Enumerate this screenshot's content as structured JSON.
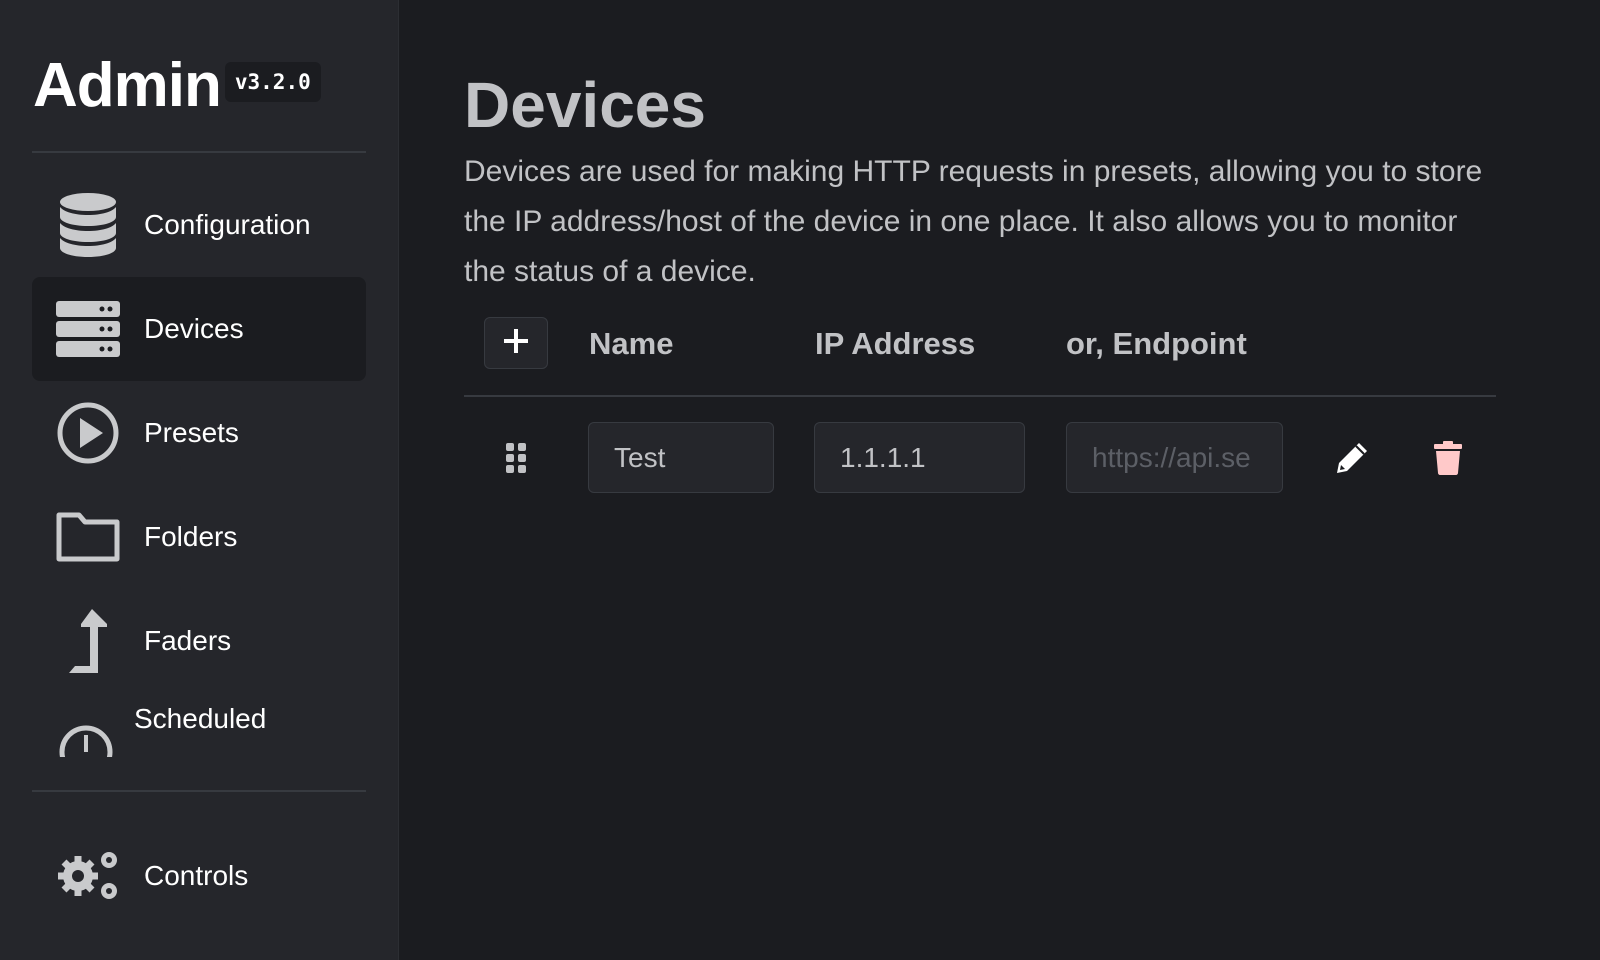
{
  "sidebar": {
    "title": "Admin",
    "version": "v3.2.0",
    "items": [
      {
        "label": "Configuration",
        "icon": "database-icon"
      },
      {
        "label": "Devices",
        "icon": "server-icon",
        "active": true
      },
      {
        "label": "Presets",
        "icon": "play-circle-icon"
      },
      {
        "label": "Folders",
        "icon": "folder-icon"
      },
      {
        "label": "Faders",
        "icon": "arrow-up-turn-icon"
      },
      {
        "label": "Scheduled",
        "icon": "clock-icon"
      }
    ],
    "footer_item": {
      "label": "Controls",
      "icon": "gears-icon"
    }
  },
  "main": {
    "title": "Devices",
    "description": "Devices are used for making HTTP requests in presets, allowing you to store the IP address/host of the device in one place. It also allows you to monitor the status of a device.",
    "table": {
      "add_icon": "plus-icon",
      "columns": [
        "Name",
        "IP Address",
        "or, Endpoint"
      ],
      "rows": [
        {
          "name": "Test",
          "ip": "1.1.1.1",
          "endpoint": "",
          "endpoint_placeholder": "https://api.se"
        }
      ]
    }
  },
  "colors": {
    "background": "#1b1c20",
    "sidebar": "#25262b",
    "delete": "#ffc9c9"
  }
}
